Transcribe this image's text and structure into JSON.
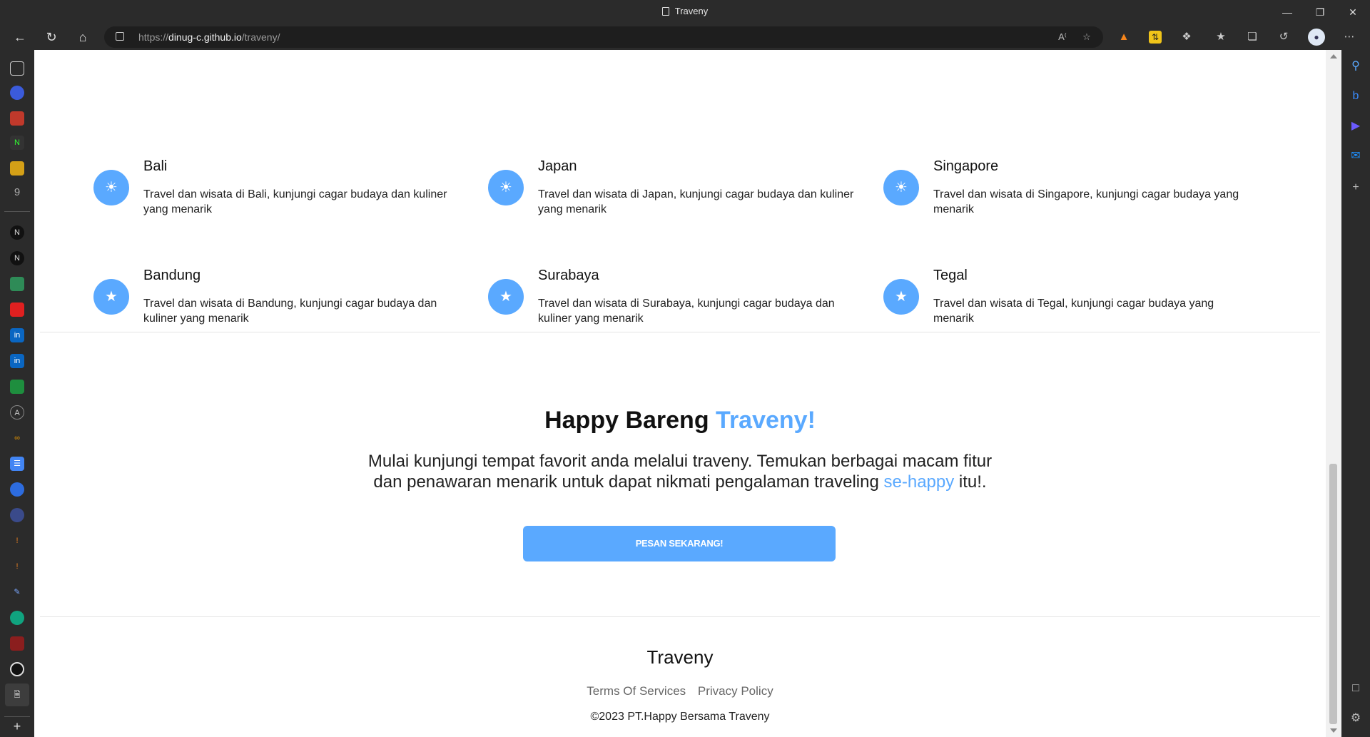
{
  "browser": {
    "tab_title": "Traveny",
    "url_prefix": "https://",
    "url_host": "dinug-c.github.io",
    "url_path": "/traveny/"
  },
  "destinations": [
    {
      "name": "Bali",
      "desc": "Travel dan wisata di Bali, kunjungi cagar budaya dan kuliner yang menarik",
      "icon": "lightbulb-icon"
    },
    {
      "name": "Japan",
      "desc": "Travel dan wisata di Japan, kunjungi cagar budaya dan kuliner yang menarik",
      "icon": "lightbulb-icon"
    },
    {
      "name": "Singapore",
      "desc": "Travel dan wisata di Singapore, kunjungi cagar budaya yang menarik",
      "icon": "lightbulb-icon"
    },
    {
      "name": "Bandung",
      "desc": "Travel dan wisata di Bandung, kunjungi cagar budaya dan kuliner yang menarik",
      "icon": "star-icon"
    },
    {
      "name": "Surabaya",
      "desc": "Travel dan wisata di Surabaya, kunjungi cagar budaya dan kuliner yang menarik",
      "icon": "star-icon"
    },
    {
      "name": "Tegal",
      "desc": "Travel dan wisata di Tegal, kunjungi cagar budaya yang menarik",
      "icon": "star-icon"
    }
  ],
  "cta": {
    "title_main": "Happy Bareng ",
    "title_accent": "Traveny!",
    "text_main": "Mulai kunjungi tempat favorit anda melalui traveny. Temukan berbagai macam fitur dan penawaran menarik untuk dapat nikmati pengalaman traveling ",
    "text_accent": "se-happy",
    "text_end": " itu!.",
    "button_label": "PESAN SEKARANG!"
  },
  "footer": {
    "brand": "Traveny",
    "links": [
      "Terms Of Services",
      "Privacy Policy"
    ],
    "copyright": "©2023 PT.Happy Bersama Traveny"
  },
  "colors": {
    "accent": "#5aa9ff",
    "chrome": "#2b2b2b"
  }
}
